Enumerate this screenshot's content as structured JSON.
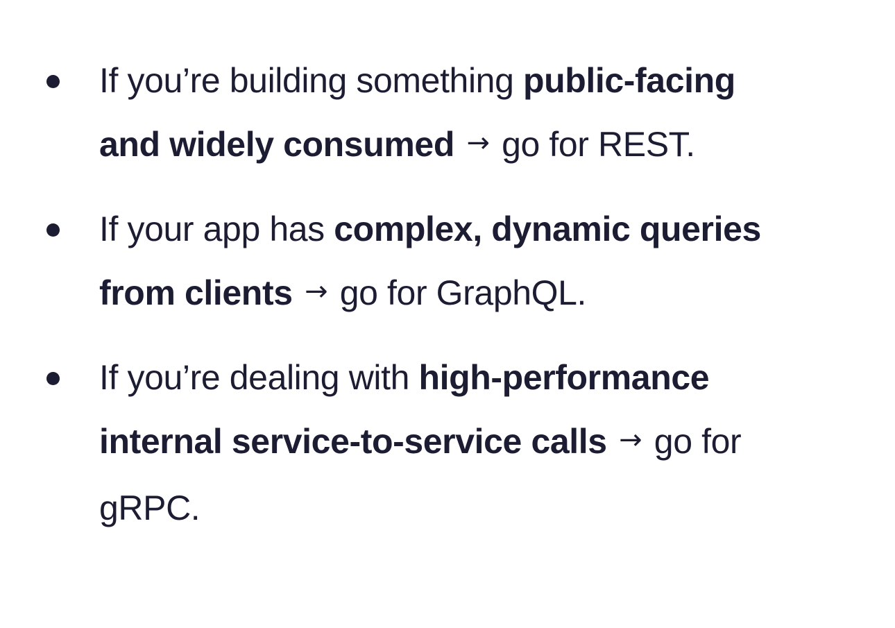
{
  "colors": {
    "text": "#1c1c33",
    "background": "#ffffff"
  },
  "items": [
    {
      "prefix": "If you’re building something ",
      "emphasis": "public-facing and widely consumed",
      "arrow": "→",
      "suffix": "go for REST."
    },
    {
      "prefix": "If your app has ",
      "emphasis": "complex, dynamic queries from clients",
      "arrow": "→",
      "suffix": "go for GraphQL."
    },
    {
      "prefix": "If you’re dealing with ",
      "emphasis": "high-performance internal service-to-service calls",
      "arrow": "→",
      "suffix": "go for gRPC."
    }
  ]
}
